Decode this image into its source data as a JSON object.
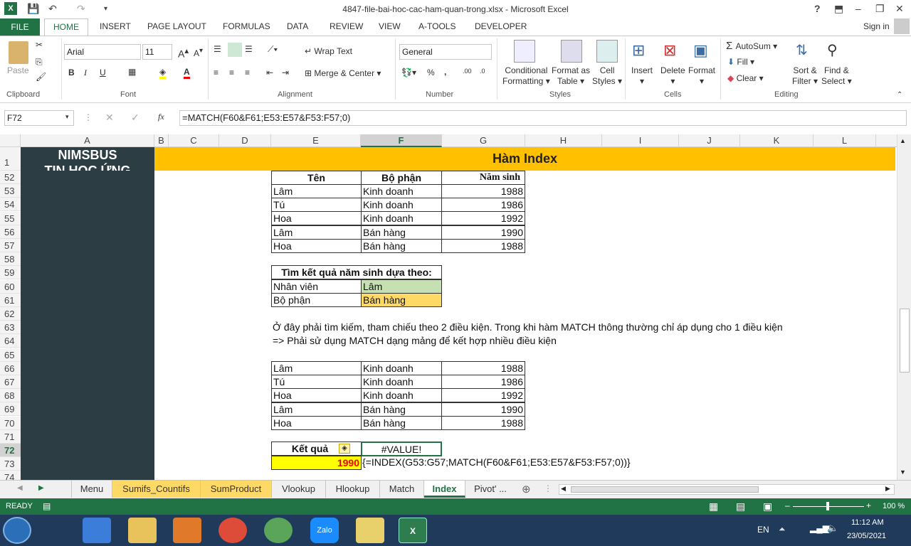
{
  "app": {
    "title": "4847-file-bai-hoc-cac-ham-quan-trong.xlsx - Microsoft Excel",
    "help": "?",
    "signin": "Sign in"
  },
  "ribbon_tabs": [
    "FILE",
    "HOME",
    "INSERT",
    "PAGE LAYOUT",
    "FORMULAS",
    "DATA",
    "REVIEW",
    "VIEW",
    "A-TOOLS",
    "DEVELOPER"
  ],
  "clipboard": {
    "paste": "Paste",
    "group": "Clipboard"
  },
  "font": {
    "name": "Arial",
    "size": "11",
    "group": "Font",
    "bold": "B",
    "italic": "I",
    "underline": "U"
  },
  "alignment": {
    "wrap": "Wrap Text",
    "merge": "Merge & Center",
    "group": "Alignment"
  },
  "number": {
    "format": "General",
    "group": "Number",
    "percent": "%",
    "comma": ","
  },
  "styles": {
    "cond1": "Conditional",
    "cond2": "Formatting",
    "fmt1": "Format as",
    "fmt2": "Table",
    "cell1": "Cell",
    "cell2": "Styles",
    "group": "Styles"
  },
  "cells": {
    "insert": "Insert",
    "delete": "Delete",
    "format": "Format",
    "group": "Cells"
  },
  "editing": {
    "autosum": "AutoSum",
    "fill": "Fill",
    "clear": "Clear",
    "sort1": "Sort &",
    "sort2": "Filter",
    "find1": "Find &",
    "find2": "Select",
    "group": "Editing"
  },
  "namebox": "F72",
  "formula": "=MATCH(F60&F61;E53:E57&F53:F57;0)",
  "fx": "fx",
  "columns": [
    "A",
    "B",
    "C",
    "D",
    "E",
    "F",
    "G",
    "H",
    "I",
    "J",
    "K",
    "L"
  ],
  "rows": [
    "1",
    "52",
    "53",
    "54",
    "55",
    "56",
    "57",
    "58",
    "59",
    "60",
    "61",
    "62",
    "63",
    "64",
    "65",
    "66",
    "67",
    "68",
    "69",
    "70",
    "71",
    "72",
    "73",
    "74"
  ],
  "sidebar": {
    "line1": "NIMSBUS",
    "line2": "TIN HỌC ỨNG"
  },
  "banner": "Hàm Index",
  "table1": {
    "headers": [
      "Tên",
      "Bộ phận",
      "Năm sinh"
    ],
    "rows": [
      [
        "Lâm",
        "Kinh doanh",
        "1988"
      ],
      [
        "Tú",
        "Kinh doanh",
        "1986"
      ],
      [
        "Hoa",
        "Kinh doanh",
        "1992"
      ],
      [
        "Lâm",
        "Bán hàng",
        "1990"
      ],
      [
        "Hoa",
        "Bán hàng",
        "1988"
      ]
    ]
  },
  "lookup": {
    "title": "Tìm kết quả năm sinh dựa theo:",
    "label1": "Nhân viên",
    "value1": "Lâm",
    "label2": "Bộ phận",
    "value2": "Bán hàng"
  },
  "note1": "Ở đây phải tìm kiếm, tham chiếu theo 2 điều kiện. Trong khi hàm MATCH thông thường chỉ áp dụng cho 1 điều kiện",
  "note2": "=> Phải sử dụng MATCH dạng mảng để kết hợp nhiều điều kiện",
  "table2": {
    "rows": [
      [
        "Lâm",
        "Kinh doanh",
        "1988"
      ],
      [
        "Tú",
        "Kinh doanh",
        "1986"
      ],
      [
        "Hoa",
        "Kinh doanh",
        "1992"
      ],
      [
        "Lâm",
        "Bán hàng",
        "1990"
      ],
      [
        "Hoa",
        "Bán hàng",
        "1988"
      ]
    ]
  },
  "result": {
    "label": "Kết quả",
    "error": "#VALUE!",
    "value": "1990",
    "formula": "{=INDEX(G53:G57;MATCH(F60&F61;E53:E57&F53:F57;0))}"
  },
  "sheet_tabs": [
    "Menu",
    "Sumifs_Countifs",
    "SumProduct",
    "Vlookup",
    "Hlookup",
    "Match",
    "Index",
    "Pivot' ..."
  ],
  "status": {
    "ready": "READY",
    "zoom": "100 %"
  },
  "taskbar": {
    "lang": "EN",
    "time": "11:12 AM",
    "date": "23/05/2021"
  },
  "colors": {
    "excel_green": "#217346",
    "banner": "#FFC000",
    "sidebar": "#2C3E44",
    "green_cell": "#C6E0B4",
    "orange_cell": "#FFD966",
    "yellow": "#FFFF00"
  }
}
